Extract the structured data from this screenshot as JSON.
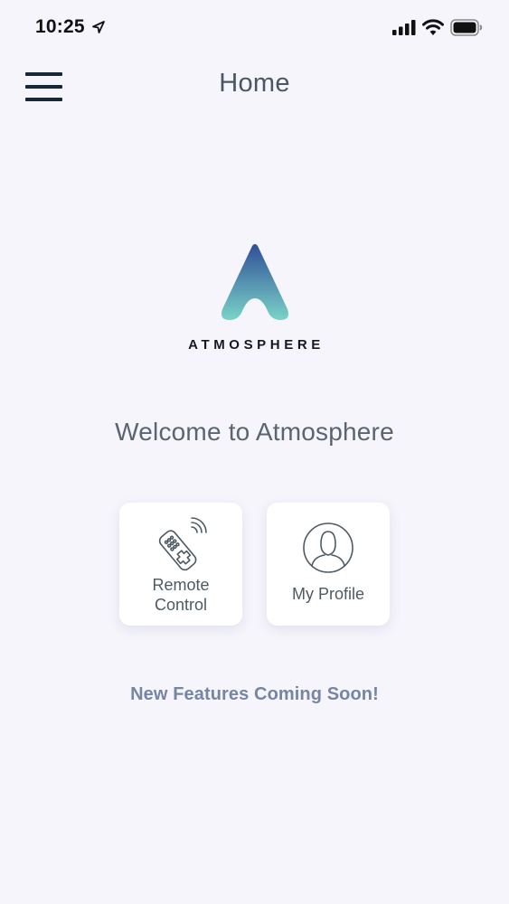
{
  "status_bar": {
    "time": "10:25",
    "icons": [
      "location-arrow-icon",
      "cellular-signal-icon",
      "wifi-icon",
      "battery-icon"
    ]
  },
  "header": {
    "title": "Home",
    "menu_icon": "hamburger-menu-icon"
  },
  "logo": {
    "wordmark": "ATMOSPHERE",
    "gradient_top": "#2f4f96",
    "gradient_bottom": "#7ad3c8"
  },
  "welcome": {
    "text": "Welcome to Atmosphere"
  },
  "tiles": [
    {
      "label": "Remote Control",
      "icon": "remote-control-icon"
    },
    {
      "label": "My Profile",
      "icon": "user-profile-icon"
    }
  ],
  "footer": {
    "features_text": "New Features Coming Soon!"
  },
  "colors": {
    "background": "#f6f5fc",
    "tile_background": "#ffffff",
    "accent_text": "#7585a3",
    "dark_text": "#17283a"
  }
}
